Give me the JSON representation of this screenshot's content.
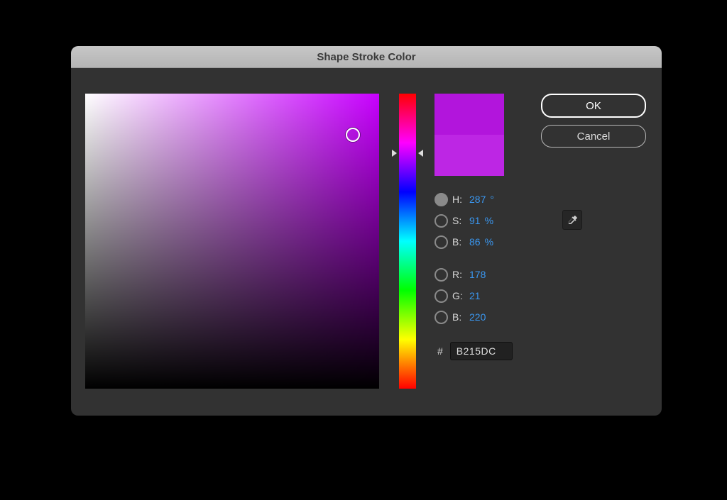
{
  "window": {
    "title": "Shape Stroke Color"
  },
  "buttons": {
    "ok": "OK",
    "cancel": "Cancel"
  },
  "picker": {
    "hue_deg": 287,
    "field_cursor": {
      "x_pct": 91,
      "y_pct": 14
    }
  },
  "swatch": {
    "new_color": "#B215DC",
    "current_color": "#BD26E4"
  },
  "hsb": {
    "h": {
      "label": "H:",
      "value": "287",
      "unit": "°",
      "selected": true
    },
    "s": {
      "label": "S:",
      "value": "91",
      "unit": "%"
    },
    "b": {
      "label": "B:",
      "value": "86",
      "unit": "%"
    }
  },
  "rgb": {
    "r": {
      "label": "R:",
      "value": "178"
    },
    "g": {
      "label": "G:",
      "value": "21"
    },
    "b": {
      "label": "B:",
      "value": "220"
    }
  },
  "hex": {
    "hash": "#",
    "value": "B215DC"
  }
}
